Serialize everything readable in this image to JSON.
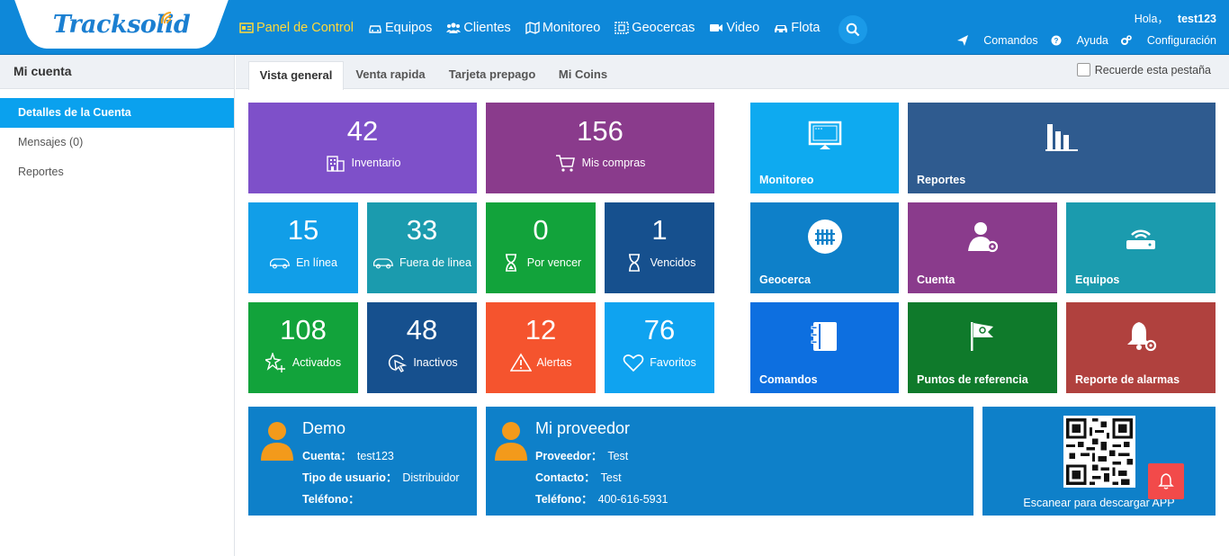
{
  "header": {
    "logo_track": "Track",
    "logo_solid": "solid",
    "nav": [
      {
        "label": "Panel de Control",
        "icon": "dashboard-icon",
        "active": true
      },
      {
        "label": "Equipos",
        "icon": "car-icon"
      },
      {
        "label": "Clientes",
        "icon": "users-icon"
      },
      {
        "label": "Monitoreo",
        "icon": "map-icon"
      },
      {
        "label": "Geocercas",
        "icon": "geofence-icon"
      },
      {
        "label": "Video",
        "icon": "video-icon"
      },
      {
        "label": "Flota",
        "icon": "fleet-icon"
      }
    ],
    "hello": "Hola，",
    "username": "test123",
    "links": {
      "commands": "Comandos",
      "help": "Ayuda",
      "config": "Configuración"
    }
  },
  "sidebar": {
    "title": "Mi cuenta",
    "items": [
      {
        "label": "Detalles de la Cuenta",
        "active": true
      },
      {
        "label": "Mensajes (0)"
      },
      {
        "label": "Reportes"
      }
    ]
  },
  "tabs": {
    "items": [
      "Vista general",
      "Venta rapida",
      "Tarjeta prepago",
      "Mi Coins"
    ],
    "remember": "Recuerde esta pestaña"
  },
  "stats": {
    "inventory": {
      "value": "42",
      "label": "Inventario"
    },
    "purchases": {
      "value": "156",
      "label": "Mis compras"
    },
    "online": {
      "value": "15",
      "label": "En línea"
    },
    "offline": {
      "value": "33",
      "label": "Fuera de linea"
    },
    "expiring": {
      "value": "0",
      "label": "Por vencer"
    },
    "expired": {
      "value": "1",
      "label": "Vencidos"
    },
    "activated": {
      "value": "108",
      "label": "Activados"
    },
    "inactive": {
      "value": "48",
      "label": "Inactivos"
    },
    "alerts": {
      "value": "12",
      "label": "Alertas"
    },
    "favorites": {
      "value": "76",
      "label": "Favoritos"
    }
  },
  "apps": {
    "monitoring": "Monitoreo",
    "reports": "Reportes",
    "geofence": "Geocerca",
    "account": "Cuenta",
    "devices": "Equipos",
    "commands": "Comandos",
    "poi": "Puntos de referencia",
    "alarm_report": "Reporte de alarmas"
  },
  "demo_card": {
    "title": "Demo",
    "account_label": "Cuenta：",
    "account_value": "test123",
    "type_label": "Tipo de usuario：",
    "type_value": "Distribuidor",
    "phone_label": "Teléfono：",
    "phone_value": ""
  },
  "provider_card": {
    "title": "Mi proveedor",
    "provider_label": "Proveedor：",
    "provider_value": "Test",
    "contact_label": "Contacto：",
    "contact_value": "Test",
    "phone_label": "Teléfono：",
    "phone_value": "400-616-5931"
  },
  "qr": {
    "label": "Escanear para descargar APP"
  },
  "colors": {
    "header": "#0e88d9",
    "purple": "#7e50c9",
    "magenta": "#8a3b8c",
    "sky": "#119ee8",
    "teal": "#1b9bae",
    "green": "#12a33b",
    "navy": "#16508e",
    "orange": "#f5542e",
    "lightblue": "#0fa3f0"
  }
}
